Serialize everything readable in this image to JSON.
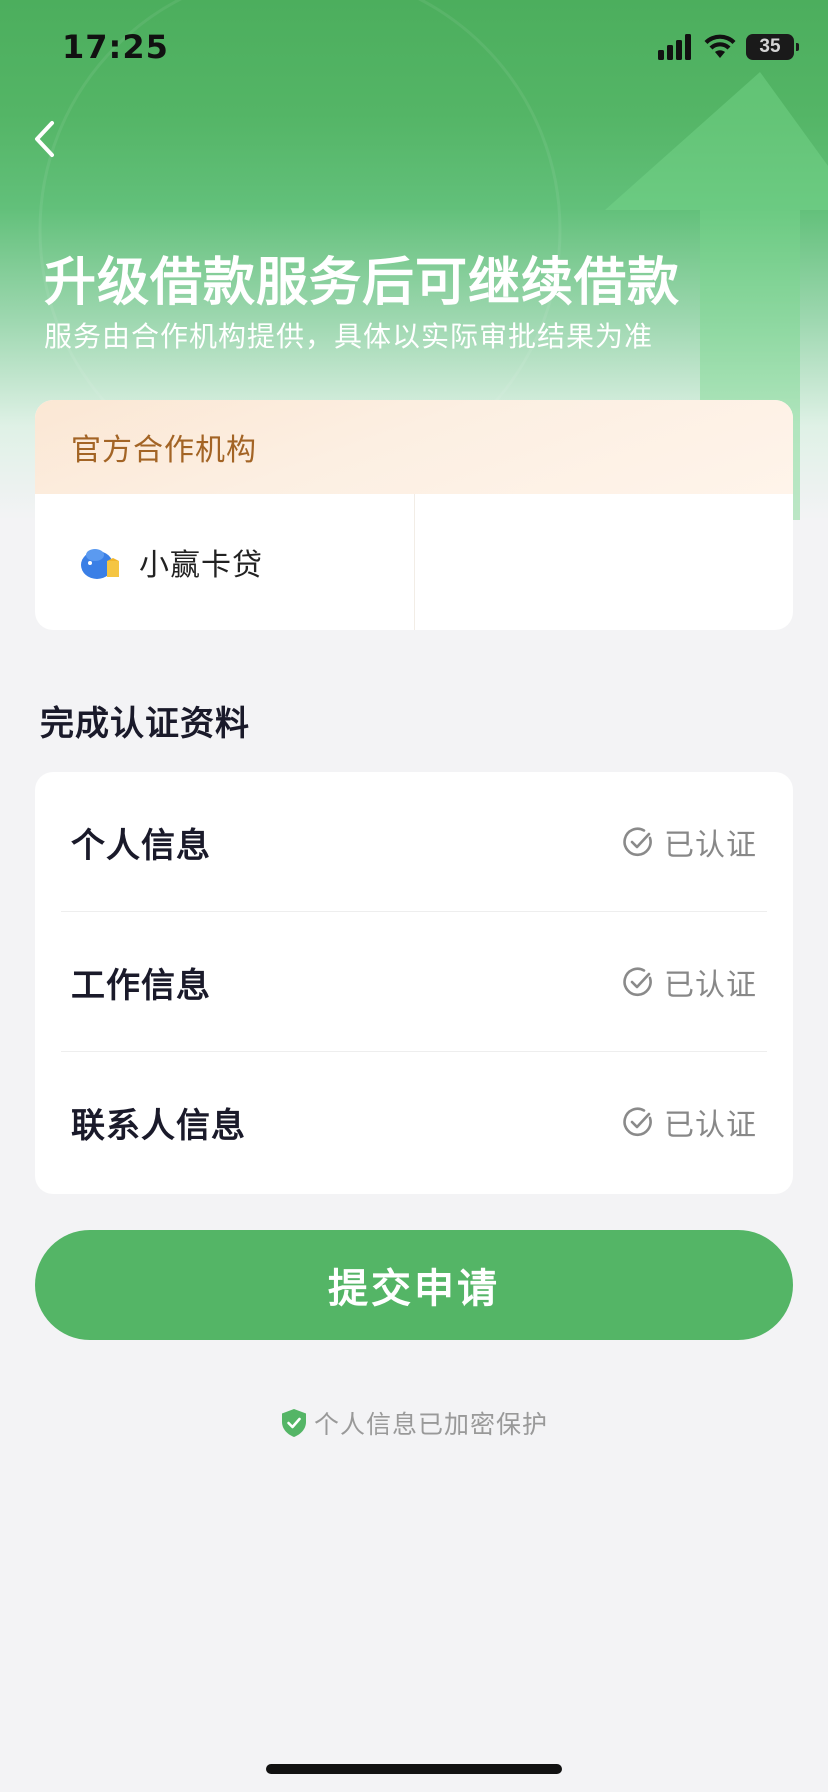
{
  "status_bar": {
    "time": "17:25",
    "battery": "35"
  },
  "header": {
    "title": "升级借款服务后可继续借款",
    "subtitle": "服务由合作机构提供，具体以实际审批结果为准"
  },
  "partner": {
    "header_label": "官方合作机构",
    "institutions": [
      {
        "name": "小赢卡贷",
        "icon": "piggy-bank-icon"
      }
    ]
  },
  "verification": {
    "section_title": "完成认证资料",
    "items": [
      {
        "label": "个人信息",
        "status": "已认证"
      },
      {
        "label": "工作信息",
        "status": "已认证"
      },
      {
        "label": "联系人信息",
        "status": "已认证"
      }
    ]
  },
  "actions": {
    "submit_label": "提交申请"
  },
  "footer": {
    "security_note": "个人信息已加密保护"
  },
  "colors": {
    "brand_green": "#54b566",
    "partner_header_text": "#a36425",
    "status_gray": "#888888"
  }
}
